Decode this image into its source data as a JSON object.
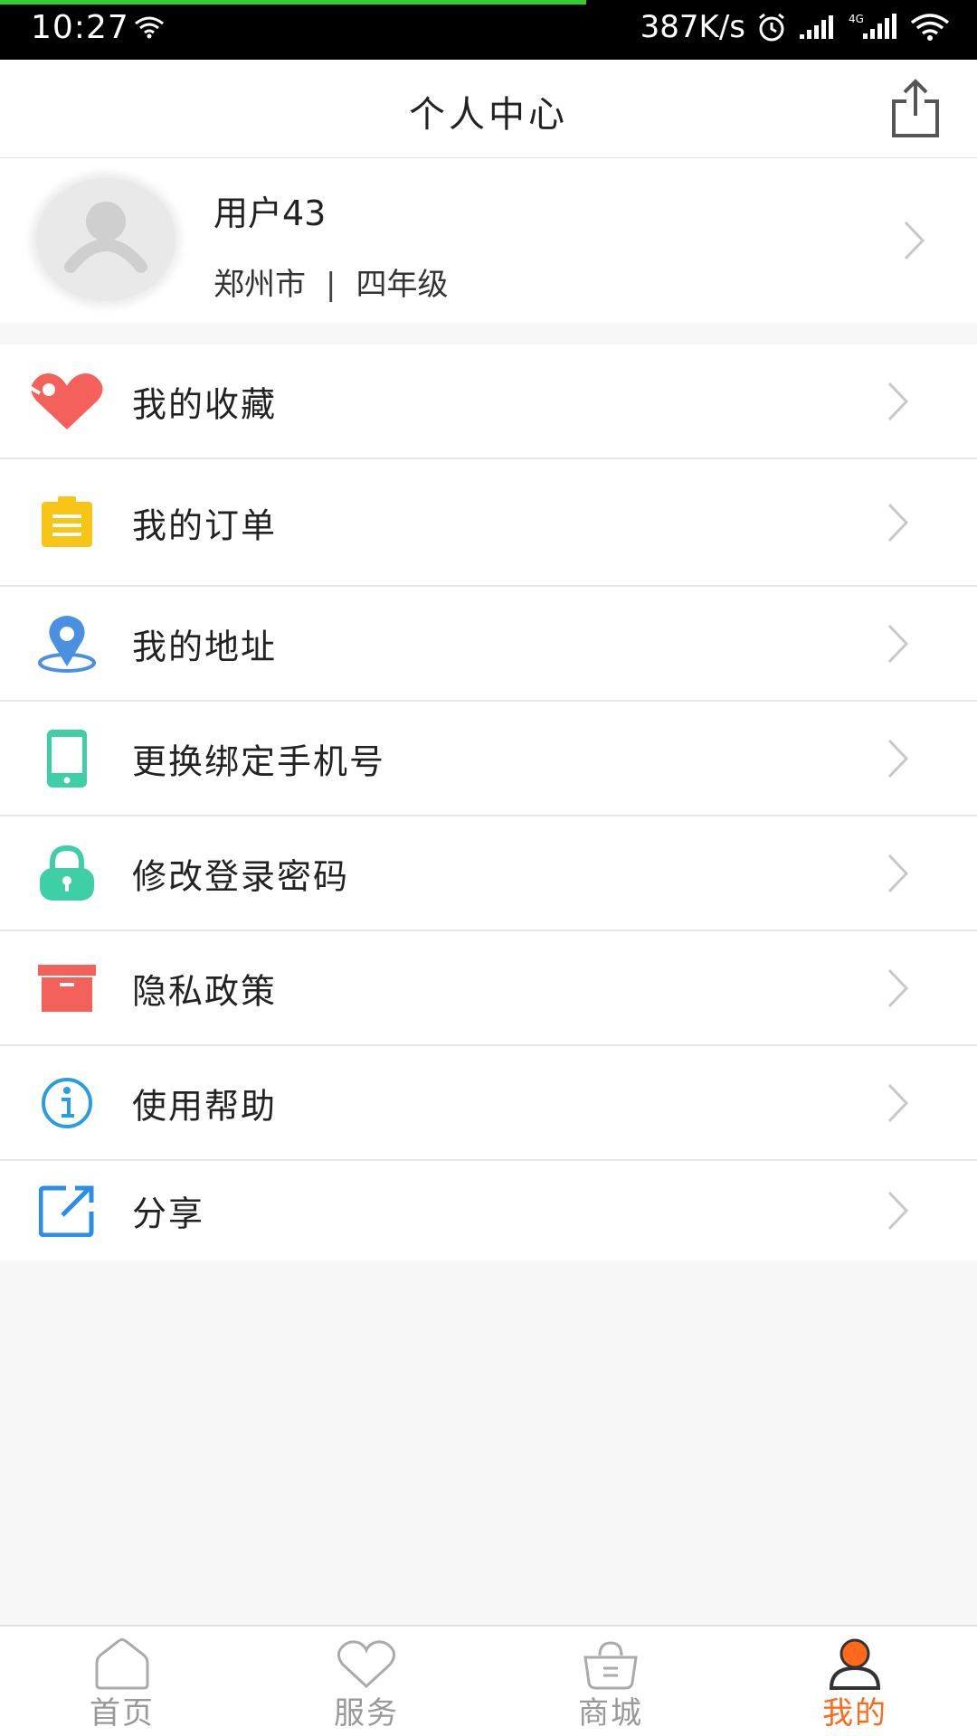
{
  "status_bar": {
    "time": "10:27",
    "speed": "387K/s",
    "network": "4G"
  },
  "header": {
    "title": "个人中心"
  },
  "profile": {
    "name": "用户43",
    "city": "郑州市",
    "separator": "|",
    "grade": "四年级"
  },
  "menu": {
    "items": [
      {
        "label": "我的收藏",
        "icon": "heart-icon",
        "color": "#f4605a"
      },
      {
        "label": "我的订单",
        "icon": "clipboard-icon",
        "color": "#f8c415"
      },
      {
        "label": "我的地址",
        "icon": "location-pin-icon",
        "color": "#4a90e2"
      },
      {
        "label": "更换绑定手机号",
        "icon": "phone-icon",
        "color": "#3ecfa7"
      },
      {
        "label": "修改登录密码",
        "icon": "lock-icon",
        "color": "#3ecfa7"
      },
      {
        "label": "隐私政策",
        "icon": "archive-box-icon",
        "color": "#f4605a"
      },
      {
        "label": "使用帮助",
        "icon": "info-icon",
        "color": "#2a9ce0"
      },
      {
        "label": "分享",
        "icon": "share-edit-icon",
        "color": "#2a8ee8"
      }
    ]
  },
  "bottom_nav": {
    "items": [
      {
        "label": "首页",
        "icon": "home-icon"
      },
      {
        "label": "服务",
        "icon": "heart-outline-icon"
      },
      {
        "label": "商城",
        "icon": "basket-icon"
      },
      {
        "label": "我的",
        "icon": "user-icon",
        "active": true
      }
    ],
    "active_color": "#ff6a1a",
    "inactive_color": "#999999"
  }
}
